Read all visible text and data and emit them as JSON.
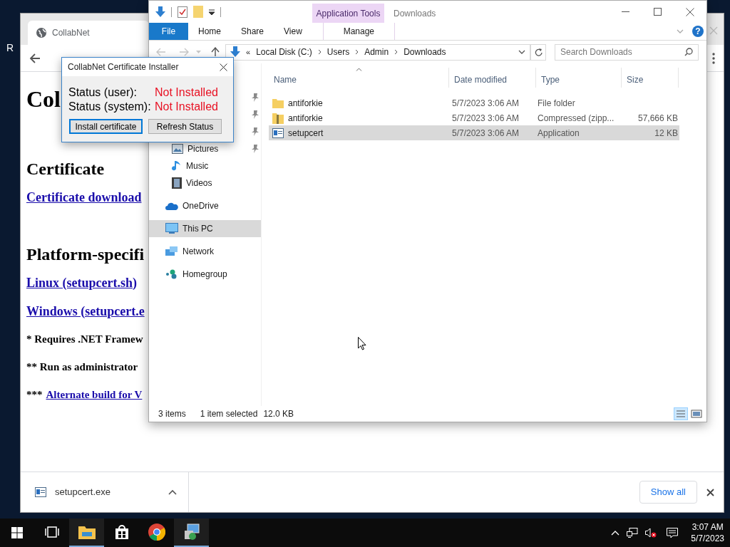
{
  "desktop": {
    "icon_label": "R"
  },
  "browser": {
    "tab_title": "CollabNet",
    "content": [
      {
        "kind": "title",
        "text": "Col"
      },
      {
        "kind": "heading",
        "text": "Certificate"
      },
      {
        "kind": "link",
        "text": "Certificate download"
      },
      {
        "kind": "heading",
        "text": "Platform-specifi"
      },
      {
        "kind": "link",
        "text": "Linux (setupcert.sh)"
      },
      {
        "kind": "link",
        "text": "Windows (setupcert.e"
      },
      {
        "kind": "note",
        "text": "* Requires .NET Framew"
      },
      {
        "kind": "note",
        "text": "** Run as administrator"
      },
      {
        "kind": "note_link",
        "text": "***",
        "link": "Alternate build for V"
      }
    ],
    "download": {
      "file": "setupcert.exe",
      "button": "Show all"
    }
  },
  "explorer": {
    "contextual_tab": "Application Tools",
    "title": "Downloads",
    "tabs": [
      {
        "label": "File",
        "kind": "file",
        "selected": false
      },
      {
        "label": "Home",
        "kind": "tab",
        "selected": false
      },
      {
        "label": "Share",
        "kind": "tab",
        "selected": false
      },
      {
        "label": "View",
        "kind": "tab",
        "selected": false
      },
      {
        "label": "Manage",
        "kind": "contextual",
        "selected": false
      }
    ],
    "help": "?",
    "breadcrumb_overflow": "«",
    "breadcrumb": [
      "Local Disk (C:)",
      "Users",
      "Admin",
      "Downloads"
    ],
    "search": {
      "placeholder": "Search Downloads"
    },
    "nav": [
      {
        "kind": "covered",
        "pinned": true,
        "selected": false
      },
      {
        "kind": "covered",
        "pinned": true,
        "selected": false
      },
      {
        "kind": "covered",
        "pinned": true,
        "selected": false
      },
      {
        "kind": "pictures",
        "label": "Pictures",
        "pinned": true,
        "selected": false
      },
      {
        "kind": "music",
        "label": "Music",
        "pinned": false,
        "selected": false
      },
      {
        "kind": "videos",
        "label": "Videos",
        "pinned": false,
        "selected": false
      },
      {
        "kind": "onedrive",
        "label": "OneDrive",
        "pinned": false,
        "selected": false
      },
      {
        "kind": "pc",
        "label": "This PC",
        "pinned": false,
        "selected": true
      },
      {
        "kind": "network",
        "label": "Network",
        "pinned": false,
        "selected": false
      },
      {
        "kind": "homegroup",
        "label": "Homegroup",
        "pinned": false,
        "selected": false
      }
    ],
    "columns": [
      "Name",
      "Date modified",
      "Type",
      "Size"
    ],
    "rows": [
      {
        "kind": "folder",
        "name": "antiforkie",
        "date": "5/7/2023 3:06 AM",
        "type": "File folder",
        "size": "",
        "selected": false
      },
      {
        "kind": "zip",
        "name": "antiforkie",
        "date": "5/7/2023 3:06 AM",
        "type": "Compressed (zipp...",
        "size": "57,666 KB",
        "selected": false
      },
      {
        "kind": "application",
        "name": "setupcert",
        "date": "5/7/2023 3:06 AM",
        "type": "Application",
        "size": "12 KB",
        "selected": true
      }
    ],
    "status": {
      "count": "3 items",
      "selection": "1 item selected",
      "size": "12.0 KB"
    }
  },
  "dialog": {
    "title": "CollabNet Certificate Installer",
    "statuses": [
      {
        "label": "Status (user):",
        "value": "Not Installed"
      },
      {
        "label": "Status (system):",
        "value": "Not Installed"
      }
    ],
    "buttons": [
      {
        "label": "Install certificate",
        "selected": true
      },
      {
        "label": "Refresh Status",
        "selected": false
      }
    ]
  },
  "taskbar": {
    "apps": [
      {
        "kind": "taskview",
        "active": false
      },
      {
        "kind": "explorer",
        "active": true
      },
      {
        "kind": "store",
        "active": false
      },
      {
        "kind": "chrome",
        "active": false
      },
      {
        "kind": "installer",
        "active": true
      }
    ],
    "time": "3:07 AM",
    "date": "5/7/2023"
  }
}
